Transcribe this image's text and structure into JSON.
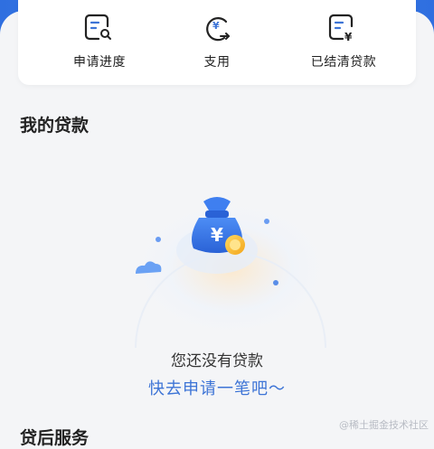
{
  "quick_actions": [
    {
      "label": "申请进度",
      "icon": "document-search-icon"
    },
    {
      "label": "支用",
      "icon": "yuan-transfer-icon"
    },
    {
      "label": "已结清贷款",
      "icon": "document-yuan-icon"
    }
  ],
  "loans_section": {
    "title": "我的贷款",
    "empty_text": "您还没有贷款",
    "cta_text": "快去申请一笔吧～"
  },
  "next_section_title": "贷后服务",
  "watermark": "@稀土掘金技术社区",
  "colors": {
    "accent": "#3d74d6",
    "header_blue": "#2f6fe0"
  }
}
